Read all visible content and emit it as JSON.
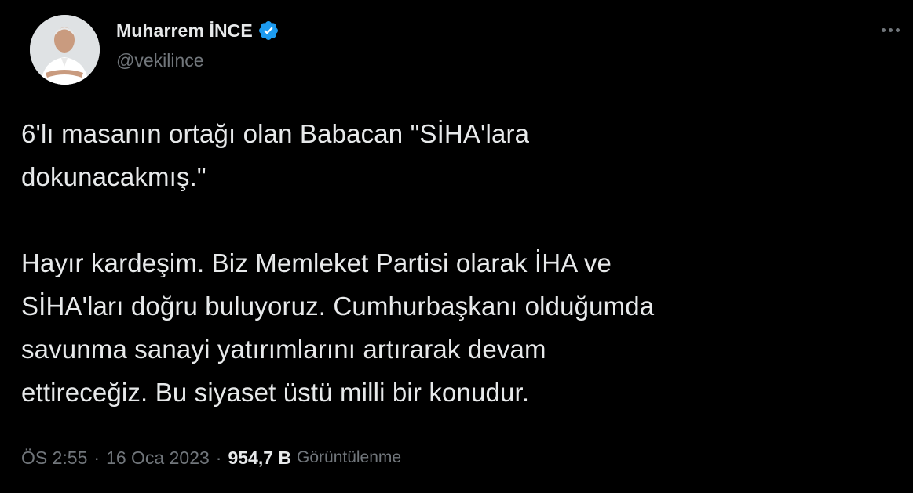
{
  "author": {
    "display_name": "Muharrem İNCE",
    "handle": "@vekilince",
    "verified": true,
    "avatar_icon": "profile-photo"
  },
  "more_icon": "more-options-icon",
  "tweet": {
    "text": "6'lı masanın ortağı olan Babacan \"SİHA'lara\ndokunacakmış.\"\n\nHayır kardeşim. Biz Memleket Partisi olarak İHA ve\nSİHA'ları doğru buluyoruz. Cumhurbaşkanı olduğumda\nsavunma sanayi yatırımlarını artırarak devam\nettireceğiz. Bu siyaset üstü milli bir konudur."
  },
  "meta": {
    "time": "ÖS 2:55",
    "separator": "·",
    "date": "16 Oca 2023",
    "views_count": "954,7 B",
    "views_label": "Görüntülenme"
  },
  "colors": {
    "background": "#000000",
    "primary_text": "#e7e9ea",
    "secondary_text": "#71767b",
    "verified_blue": "#1d9bf0"
  }
}
